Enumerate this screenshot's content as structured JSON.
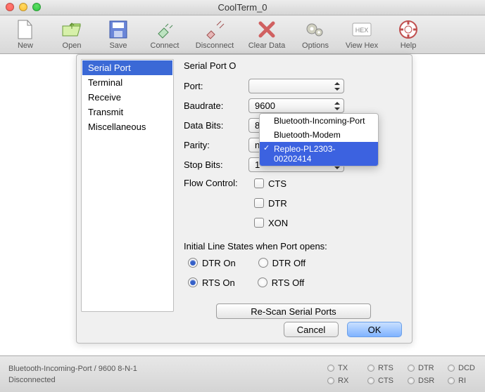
{
  "window": {
    "title": "CoolTerm_0"
  },
  "toolbar": {
    "items": [
      {
        "label": "New"
      },
      {
        "label": "Open"
      },
      {
        "label": "Save"
      },
      {
        "label": "Connect"
      },
      {
        "label": "Disconnect"
      },
      {
        "label": "Clear Data"
      },
      {
        "label": "Options"
      },
      {
        "label": "View Hex"
      },
      {
        "label": "Help"
      }
    ]
  },
  "categories": {
    "items": [
      "Serial Port",
      "Terminal",
      "Receive",
      "Transmit",
      "Miscellaneous"
    ],
    "selected_index": 0
  },
  "serial_options": {
    "section_title": "Serial Port O",
    "port_label": "Port:",
    "baudrate_label": "Baudrate:",
    "baudrate_value": "9600",
    "databits_label": "Data Bits:",
    "databits_value": "8",
    "parity_label": "Parity:",
    "parity_value": "none",
    "stopbits_label": "Stop Bits:",
    "stopbits_value": "1",
    "flowcontrol_label": "Flow Control:",
    "fc_cts": "CTS",
    "fc_dtr": "DTR",
    "fc_xon": "XON",
    "initial_states_label": "Initial Line States when Port opens:",
    "dtr_on": "DTR On",
    "dtr_off": "DTR Off",
    "rts_on": "RTS On",
    "rts_off": "RTS Off",
    "rescan_label": "Re-Scan Serial Ports"
  },
  "port_menu": {
    "items": [
      "Bluetooth-Incoming-Port",
      "Bluetooth-Modem",
      "Repleo-PL2303-00202414"
    ],
    "selected_index": 2
  },
  "dialog_buttons": {
    "cancel": "Cancel",
    "ok": "OK"
  },
  "status": {
    "line1": "Bluetooth-Incoming-Port / 9600 8-N-1",
    "line2": "Disconnected",
    "leds": {
      "tx": "TX",
      "rx": "RX",
      "rts": "RTS",
      "cts": "CTS",
      "dtr": "DTR",
      "dsr": "DSR",
      "dcd": "DCD",
      "ri": "RI"
    }
  }
}
